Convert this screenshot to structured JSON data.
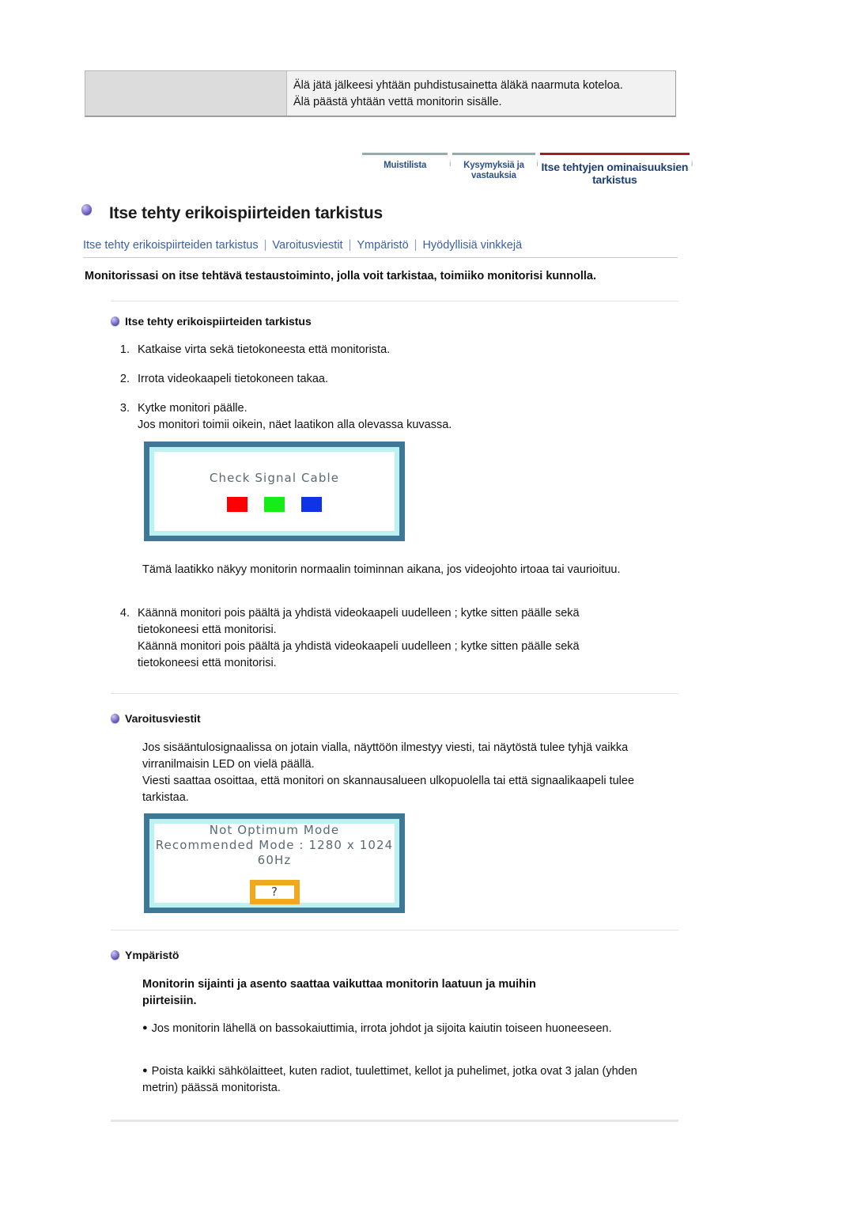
{
  "caution": {
    "line1": "Älä jätä jälkeesi yhtään puhdistusainetta äläkä naarmuta koteloa.",
    "line2": "Älä päästä yhtään vettä monitorin sisälle."
  },
  "tabs": [
    {
      "label": "Muistilista",
      "active": false
    },
    {
      "label": "Kysymyksiä ja vastauksia",
      "active": false
    },
    {
      "label": "Itse tehtyjen ominaisuuksien tarkistus",
      "active": true
    }
  ],
  "tab_separator": "i",
  "page": {
    "title": "Itse tehty erikoispiirteiden tarkistus",
    "bullet_icon": "purple-sphere-icon",
    "lead": "Monitorissasi on itse tehtävä testaustoiminto, jolla voit tarkistaa, toimiiko monitorisi kunnolla."
  },
  "subnav": {
    "links": [
      "Itse tehty erikoispiirteiden tarkistus",
      "Varoitusviestit",
      "Ympäristö",
      "Hyödyllisiä vinkkejä"
    ],
    "separator": "|"
  },
  "section1": {
    "heading": "Itse tehty erikoispiirteiden tarkistus",
    "steps": [
      {
        "num": "1.",
        "lines": [
          "Katkaise virta sekä tietokoneesta että monitorista."
        ]
      },
      {
        "num": "2.",
        "lines": [
          "Irrota videokaapeli tietokoneen takaa."
        ]
      },
      {
        "num": "3.",
        "lines": [
          "Kytke monitori päälle.",
          "Jos monitori toimii oikein, näet laatikon alla olevassa kuvassa."
        ]
      }
    ],
    "osd": {
      "title": "Check Signal Cable",
      "swatches": [
        "#fe0000",
        "#18ec18",
        "#1033e8"
      ]
    },
    "note": "Tämä laatikko näkyy monitorin normaalin toiminnan aikana, jos videojohto irtoaa tai vaurioituu.",
    "step4": {
      "num": "4.",
      "lines": [
        "Käännä monitori pois päältä ja yhdistä videokaapeli uudelleen ; kytke sitten päälle sekä tietokoneesi että monitorisi.",
        "Käännä monitori pois päältä ja yhdistä videokaapeli uudelleen ; kytke sitten päälle sekä tietokoneesi että monitorisi."
      ]
    }
  },
  "section2": {
    "heading": "Varoitusviestit",
    "paragraph1": "Jos sisääntulosignaalissa on jotain vialla, näyttöön ilmestyy viesti, tai näytöstä tulee tyhjä vaikka virranilmaisin LED on vielä päällä.",
    "paragraph2": "Viesti saattaa osoittaa, että monitori on skannausalueen ulkopuolella tai että signaalikaapeli tulee tarkistaa.",
    "osd": {
      "line1": "Not Optimum Mode",
      "line2": "Recommended Mode : 1280 x 1024  60Hz",
      "question_mark": "?",
      "question_box_color": "#f0a81e"
    }
  },
  "section3": {
    "heading": "Ympäristö",
    "intro": "Monitorin sijainti ja asento saattaa vaikuttaa monitorin laatuun ja muihin piirteisiin.",
    "bullets": [
      "Jos monitorin lähellä on bassokaiuttimia, irrota johdot ja sijoita kaiutin toiseen huoneeseen.",
      "Poista kaikki sähkölaitteet, kuten radiot, tuulettimet, kellot ja puhelimet, jotka ovat 3 jalan (yhden metrin) päässä monitorista."
    ],
    "bullet_char": "●"
  },
  "colors": {
    "link": "#3a5fa8",
    "active_tab_border": "#a41d21",
    "inactive_tab_border": "#93acac",
    "osd_frame": "#3f7897",
    "osd_inner_border": "#bdf2f2"
  }
}
